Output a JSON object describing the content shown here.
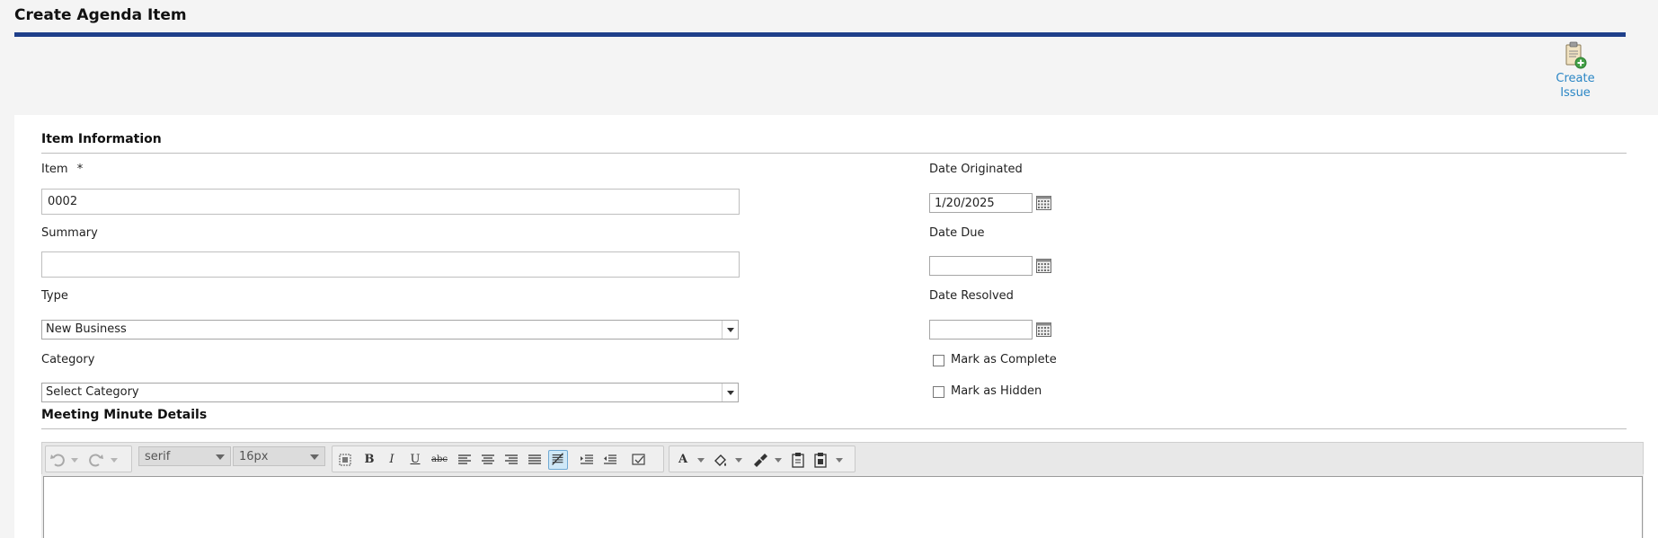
{
  "page": {
    "title": "Create Agenda Item"
  },
  "actions": {
    "create_issue_label_1": "Create",
    "create_issue_label_2": "Issue"
  },
  "item_information": {
    "section_title": "Item Information",
    "item": {
      "label": "Item",
      "required_mark": "*",
      "value": "0002"
    },
    "summary": {
      "label": "Summary",
      "value": ""
    },
    "type": {
      "label": "Type",
      "selected": "New Business"
    },
    "category": {
      "label": "Category",
      "selected": "Select Category"
    },
    "date_originated": {
      "label": "Date Originated",
      "value": "1/20/2025"
    },
    "date_due": {
      "label": "Date Due",
      "value": ""
    },
    "date_resolved": {
      "label": "Date Resolved",
      "value": ""
    },
    "mark_complete": {
      "label": "Mark as Complete",
      "checked": false
    },
    "mark_hidden": {
      "label": "Mark as Hidden",
      "checked": false
    }
  },
  "meeting_minutes": {
    "section_title": "Meeting Minute Details",
    "editor": {
      "font_family": "serif",
      "font_size": "16px"
    }
  },
  "colors": {
    "title_rule": "#1f3f8a",
    "link": "#2a86c5",
    "active_button": "#cfe8f7"
  },
  "icons": {
    "create_issue": "clipboard-add-icon",
    "calendar": "calendar-icon",
    "undo": "undo-icon",
    "redo": "redo-icon"
  }
}
